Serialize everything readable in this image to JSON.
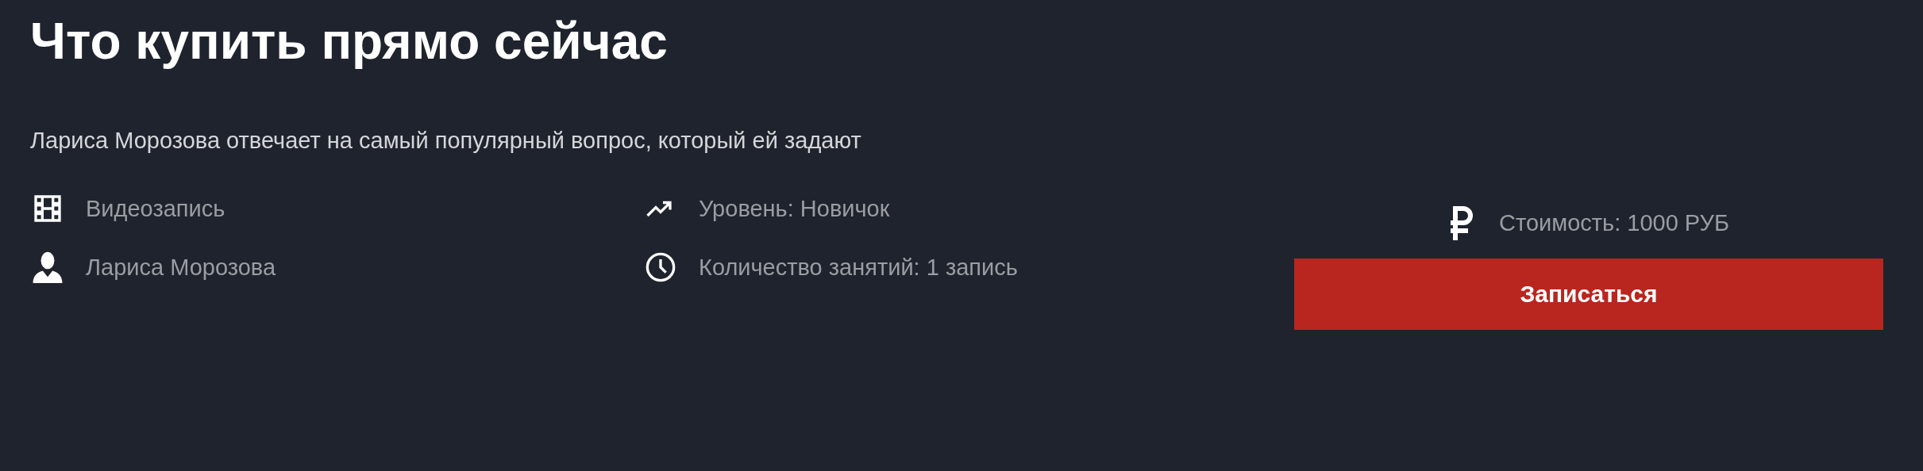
{
  "title": "Что купить прямо сейчас",
  "description": "Лариса Морозова отвечает на самый популярный вопрос, который ей задают",
  "details": [
    {
      "kind": "format",
      "text": "Видеозапись"
    },
    {
      "kind": "level",
      "text": "Уровень: Новичок"
    },
    {
      "kind": "author",
      "text": "Лариса Морозова"
    },
    {
      "kind": "lessons",
      "text": "Количество занятий: 1 запись"
    }
  ],
  "price": {
    "text": "Стоимость: 1000 РУБ"
  },
  "button": {
    "label": "Записаться"
  }
}
